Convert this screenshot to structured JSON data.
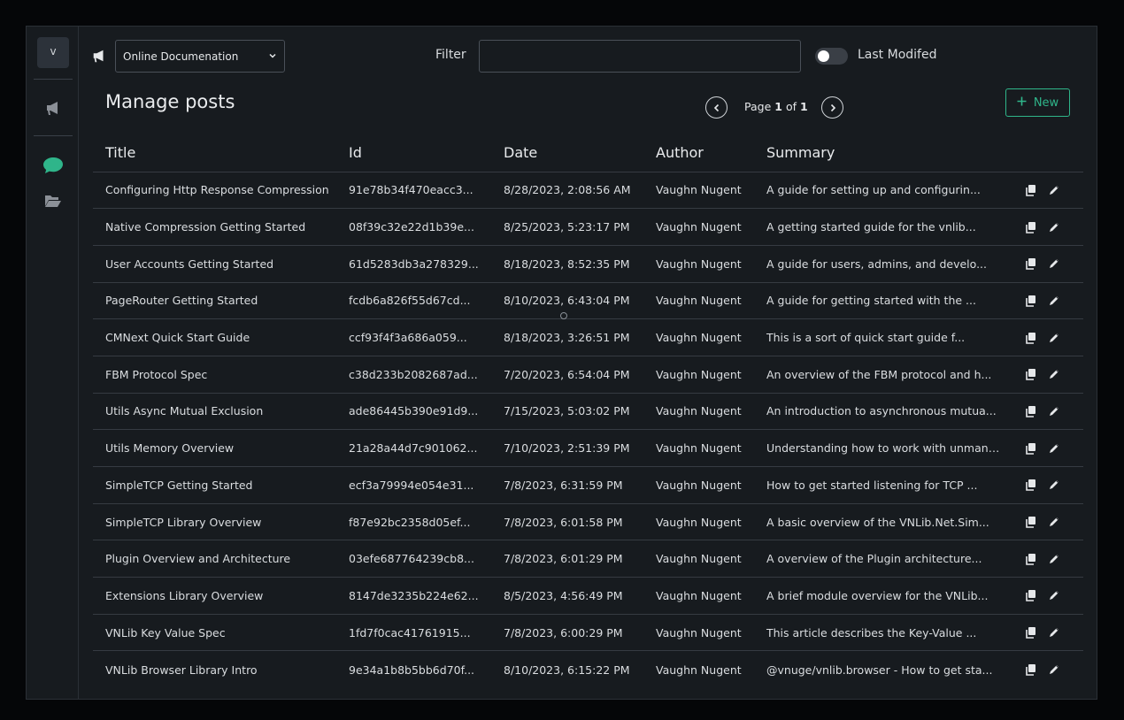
{
  "user": {
    "initial": "v"
  },
  "toolbar": {
    "channel_selected": "Online Documenation",
    "filter_label": "Filter",
    "filter_value": "",
    "toggle_label": "Last Modifed",
    "toggle_on": false
  },
  "page": {
    "title": "Manage posts"
  },
  "pager": {
    "prefix": "Page",
    "current": "1",
    "of": "of",
    "total": "1"
  },
  "new_button": {
    "label": "New"
  },
  "colors": {
    "accent": "#2fb58a",
    "background": "#171b1f"
  },
  "icons": {
    "rail": [
      "megaphone-icon",
      "chat-bubble-icon",
      "folder-open-icon"
    ],
    "row_actions": [
      "copy-icon",
      "pencil-icon"
    ]
  },
  "table": {
    "columns": [
      "Title",
      "Id",
      "Date",
      "Author",
      "Summary"
    ],
    "rows": [
      [
        "Configuring Http Response Compression",
        "91e78b34f470eacc3...",
        "8/28/2023, 2:08:56 AM",
        "Vaughn Nugent",
        "A guide for setting up and configurin..."
      ],
      [
        "Native Compression Getting Started",
        "08f39c32e22d1b39e...",
        "8/25/2023, 5:23:17 PM",
        "Vaughn Nugent",
        "A getting started guide for the vnlib..."
      ],
      [
        "User Accounts Getting Started",
        "61d5283db3a278329...",
        "8/18/2023, 8:52:35 PM",
        "Vaughn Nugent",
        "A guide for users, admins, and develo..."
      ],
      [
        "PageRouter Getting Started",
        "fcdb6a826f55d67cd...",
        "8/10/2023, 6:43:04 PM",
        "Vaughn Nugent",
        "A guide for getting started with the ..."
      ],
      [
        "CMNext Quick Start Guide",
        "ccf93f4f3a686a059...",
        "8/18/2023, 3:26:51 PM",
        "Vaughn Nugent",
        "This is a sort of quick start guide f..."
      ],
      [
        "FBM Protocol Spec",
        "c38d233b2082687ad...",
        "7/20/2023, 6:54:04 PM",
        "Vaughn Nugent",
        "An overview of the FBM protocol and h..."
      ],
      [
        "Utils Async Mutual Exclusion",
        "ade86445b390e91d9...",
        "7/15/2023, 5:03:02 PM",
        "Vaughn Nugent",
        "An introduction to asynchronous mutua..."
      ],
      [
        "Utils Memory Overview",
        "21a28a44d7c901062...",
        "7/10/2023, 2:51:39 PM",
        "Vaughn Nugent",
        "Understanding how to work with unmana..."
      ],
      [
        "SimpleTCP Getting Started",
        "ecf3a79994e054e31...",
        "7/8/2023, 6:31:59 PM",
        "Vaughn Nugent",
        "How to get started listening for TCP ..."
      ],
      [
        "SimpleTCP Library Overview",
        "f87e92bc2358d05ef...",
        "7/8/2023, 6:01:58 PM",
        "Vaughn Nugent",
        "A basic overview of the VNLib.Net.Sim..."
      ],
      [
        "Plugin Overview and Architecture",
        "03efe687764239cb8...",
        "7/8/2023, 6:01:29 PM",
        "Vaughn Nugent",
        "A overview of the Plugin architecture..."
      ],
      [
        "Extensions Library Overview",
        "8147de3235b224e62...",
        "8/5/2023, 4:56:49 PM",
        "Vaughn Nugent",
        "A brief module overview for the VNLib..."
      ],
      [
        "VNLib Key Value Spec",
        "1fd7f0cac41761915...",
        "7/8/2023, 6:00:29 PM",
        "Vaughn Nugent",
        "This article describes the Key-Value ..."
      ],
      [
        "VNLib Browser Library Intro",
        "9e34a1b8b5bb6d70f...",
        "8/10/2023, 6:15:22 PM",
        "Vaughn Nugent",
        "@vnuge/vnlib.browser - How to get sta..."
      ]
    ]
  }
}
